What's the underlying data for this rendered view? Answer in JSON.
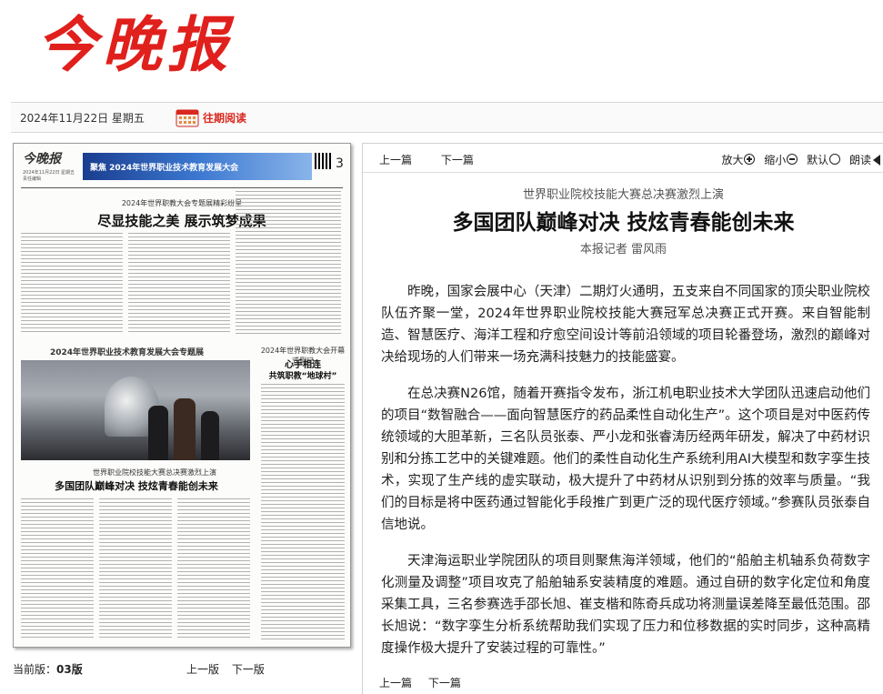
{
  "masthead": {
    "title": "今晚报"
  },
  "datebar": {
    "date": "2024年11月22日 星期五",
    "past_link": "往期阅读",
    "calendar_icon": "calendar-icon"
  },
  "paper": {
    "logo": "今晚报",
    "meta": "2024年11月22日 星期五 责任编辑",
    "band_title": "聚焦 2024年世界职业技术教育发展大会",
    "page_no": "3",
    "kicker1": "2024年世界职教大会专题展精彩纷呈",
    "head1": "尽显技能之美 展示筑梦成果",
    "photo_caption": "2024年世界职业技术教育发展大会专题展",
    "kicker2": "2024年世界职教大会开幕式侧记",
    "head2a": "心手相连",
    "head2b": "共筑职教“地球村”",
    "kicker3": "世界职业院校技能大赛总决赛激烈上演",
    "head3": "多国团队巅峰对决 技炫青春能创未来"
  },
  "reader": {
    "prev": "上一篇",
    "next": "下一篇",
    "tools": {
      "bigger": "放大",
      "smaller": "缩小",
      "default": "默认",
      "read": "朗读"
    },
    "subhead": "世界职业院校技能大赛总决赛激烈上演",
    "headline": "多国团队巅峰对决  技炫青春能创未来",
    "byline": "本报记者 雷风雨",
    "paragraphs": [
      "昨晚，国家会展中心（天津）二期灯火通明，五支来自不同国家的顶尖职业院校队伍齐聚一堂，2024年世界职业院校技能大赛冠军总决赛正式开赛。来自智能制造、智慧医疗、海洋工程和疗愈空间设计等前沿领域的项目轮番登场，激烈的巅峰对决给现场的人们带来一场充满科技魅力的技能盛宴。",
      "在总决赛N26馆，随着开赛指令发布，浙江机电职业技术大学团队迅速启动他们的项目“数智融合——面向智慧医疗的药品柔性自动化生产”。这个项目是对中医药传统领域的大胆革新，三名队员张泰、严小龙和张睿涛历经两年研发，解决了中药材识别和分拣工艺中的关键难题。他们的柔性自动化生产系统利用AI大模型和数字孪生技术，实现了生产线的虚实联动，极大提升了中药材从识别到分拣的效率与质量。“我们的目标是将中医药通过智能化手段推广到更广泛的现代医疗领域。”参赛队员张泰自信地说。",
      "天津海运职业学院团队的项目则聚焦海洋领域，他们的“船舶主机轴系负荷数字化测量及调整”项目攻克了船舶轴系安装精度的难题。通过自研的数字化定位和角度采集工具，三名参赛选手邵长旭、崔支楷和陈奇兵成功将测量误差降至最低范围。邵长旭说：“数字孪生分析系统帮助我们实现了压力和位移数据的实时同步，这种高精度操作极大提升了安装过程的可靠性。”"
    ]
  },
  "footer": {
    "current_label": "当前版：",
    "current_value": "03版",
    "prev_page": "上一版",
    "next_page": "下一版"
  }
}
